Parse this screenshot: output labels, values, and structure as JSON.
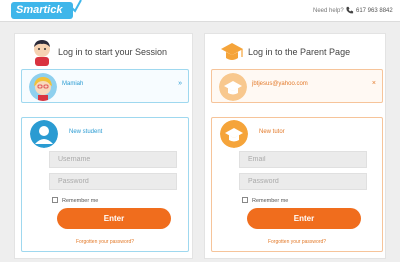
{
  "header": {
    "logo_text": "Smartick",
    "help_label": "Need help?",
    "phone": "617 963 8842"
  },
  "student_panel": {
    "title": "Log in to start your Session",
    "account_name": "Mamiah",
    "account_arrow": "»",
    "new_label": "New student",
    "username_placeholder": "Username",
    "password_placeholder": "Password",
    "remember_label": "Remember me",
    "enter_label": "Enter",
    "forgot_label": "Forgotten your password?"
  },
  "parent_panel": {
    "title": "Log in to the Parent Page",
    "account_email": "jbtjesus@yahoo.com",
    "account_close": "×",
    "new_label": "New tutor",
    "email_placeholder": "Email",
    "password_placeholder": "Password",
    "remember_label": "Remember me",
    "enter_label": "Enter",
    "forgot_label": "Forgotten your password?"
  },
  "colors": {
    "student_accent": "#2a9bd2",
    "parent_accent": "#f5a43a",
    "button": "#f06d1d"
  },
  "icons": {
    "logo": "smartick-logo",
    "phone": "phone-icon",
    "student_head": "boy-avatar-icon",
    "parent_head": "graduation-cap-icon",
    "account_student": "girl-avatar-icon",
    "account_parent": "graduation-cap-icon",
    "new_student": "user-silhouette-icon",
    "new_tutor": "graduation-cap-icon"
  }
}
